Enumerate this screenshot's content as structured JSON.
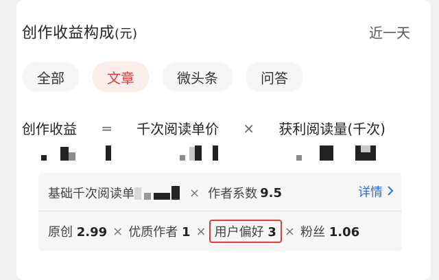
{
  "header": {
    "title": "创作收益构成",
    "unit": "(元)",
    "period": "近一天"
  },
  "tabs": [
    {
      "label": "全部"
    },
    {
      "label": "文章"
    },
    {
      "label": "微头条"
    },
    {
      "label": "问答"
    }
  ],
  "formula": {
    "income": "创作收益",
    "equals": "=",
    "unit_price": "千次阅读单价",
    "times": "×",
    "profit_reads": "获利阅读量(千次)"
  },
  "detail": {
    "base_label": "基础千次阅读单",
    "times": "×",
    "coef_label": "作者系数",
    "coef_value": "9.5",
    "more": "详情",
    "factors": {
      "original_label": "原创",
      "original_value": "2.99",
      "quality_label": "优质作者",
      "quality_value": "1",
      "pref_label": "用户偏好",
      "pref_value": "3",
      "fans_label": "粉丝",
      "fans_value": "1.06"
    }
  },
  "colors": {
    "accent": "#e03c3c",
    "link": "#2f6fd6"
  }
}
